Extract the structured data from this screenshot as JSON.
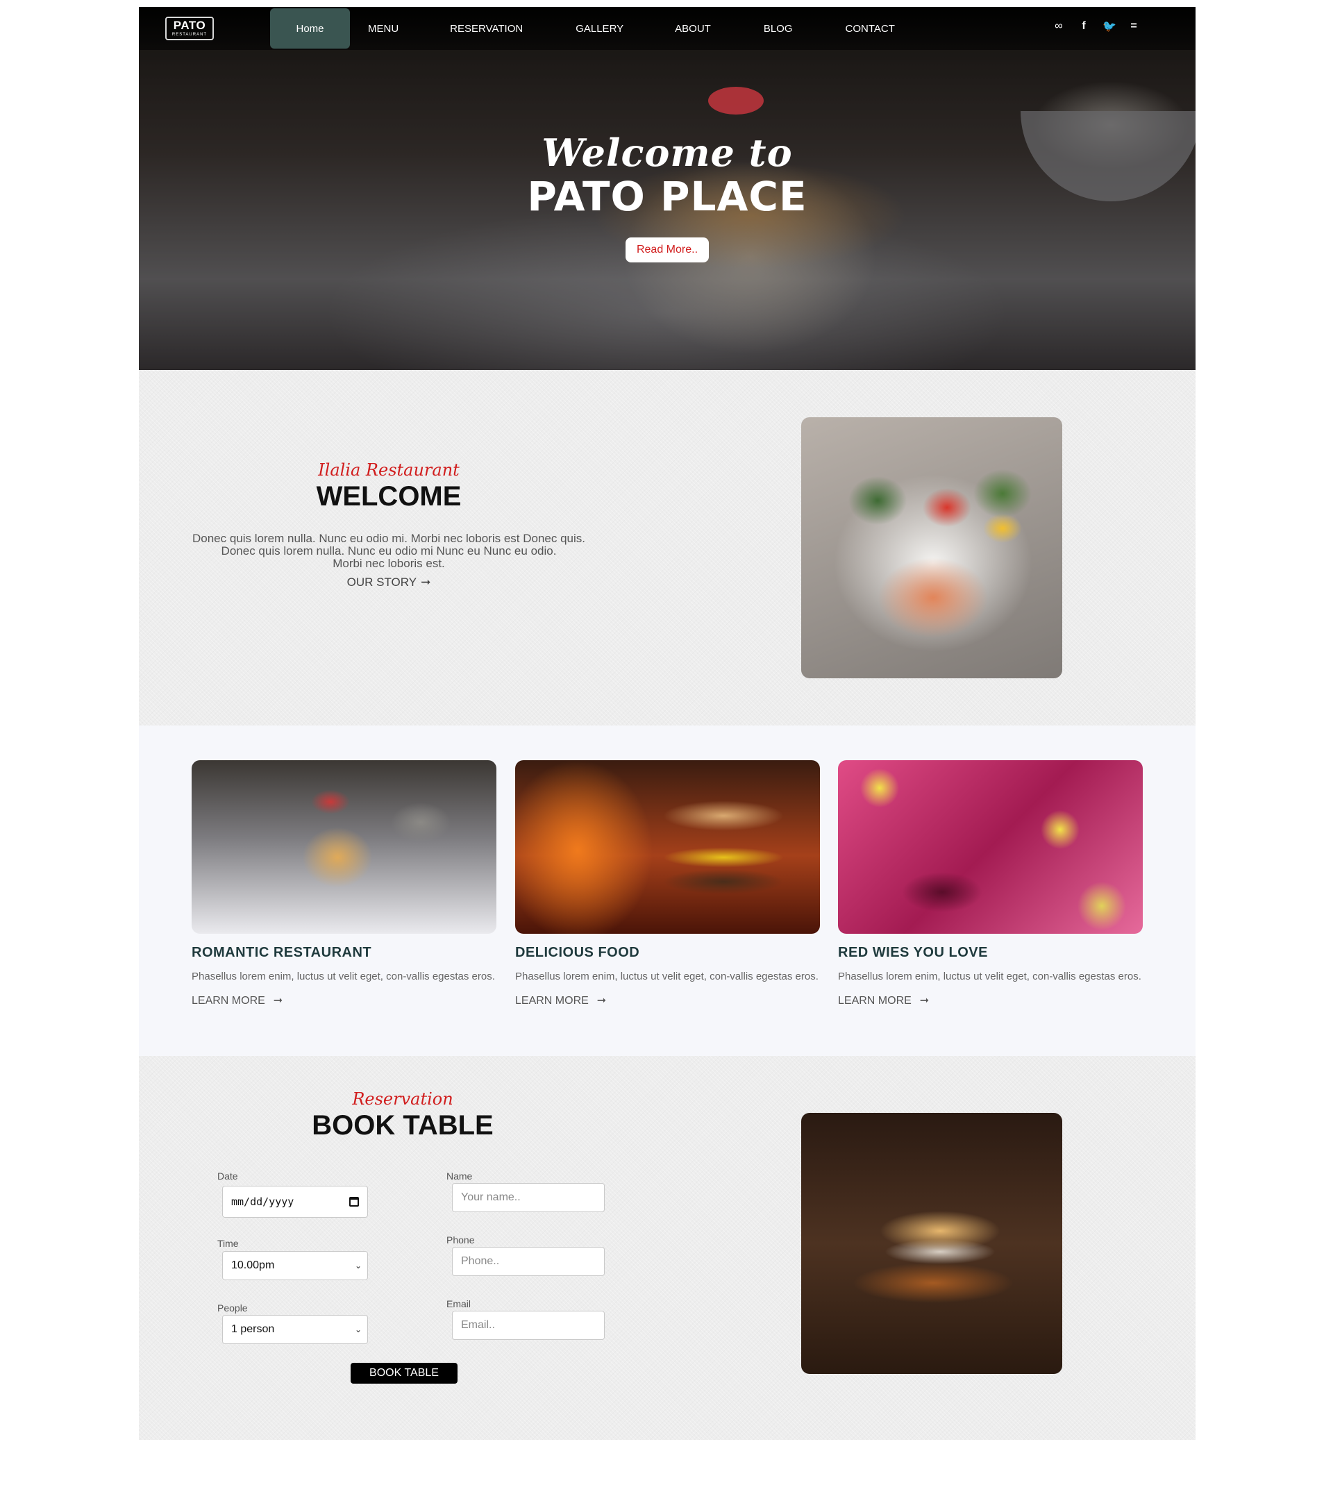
{
  "nav": {
    "logo_main": "PATO",
    "logo_sub": "RESTAURANT",
    "links": [
      "Home",
      "MENU",
      "RESERVATION",
      "GALLERY",
      "ABOUT",
      "BLOG",
      "CONTACT"
    ],
    "social": [
      "tripadvisor-icon",
      "facebook-icon",
      "twitter-icon",
      "menu-icon"
    ],
    "active_color": "#3a5551"
  },
  "hero": {
    "script": "Welcome to",
    "title": "PATO PLACE",
    "button": "Read More.."
  },
  "welcome": {
    "script": "Ilalia Restaurant",
    "title": "WELCOME",
    "paragraph_lines": [
      "Donec quis lorem nulla. Nunc eu odio mi. Morbi nec loboris est Donec quis.",
      "Donec quis lorem nulla. Nunc eu odio mi Nunc eu Nunc eu odio.",
      "Morbi nec loboris est."
    ],
    "link": "OUR STORY"
  },
  "features": [
    {
      "title": "ROMANTIC RESTAURANT",
      "text": "Phasellus lorem enim, luctus ut velit eget, con-vallis egestas eros.",
      "link": "LEARN MORE"
    },
    {
      "title": "DELICIOUS FOOD",
      "text": "Phasellus lorem enim, luctus ut velit eget, con-vallis egestas eros.",
      "link": "LEARN MORE"
    },
    {
      "title": "RED WIES YOU LOVE",
      "text": "Phasellus lorem enim, luctus ut velit eget, con-vallis egestas eros.",
      "link": "LEARN MORE"
    }
  ],
  "booking": {
    "script": "Reservation",
    "title": "BOOK TABLE",
    "date_label": "Date",
    "date_value": "mm/dd/yyyy",
    "time_label": "Time",
    "time_value": "10.00pm",
    "people_label": "People",
    "people_value": "1 person",
    "name_label": "Name",
    "name_placeholder": "Your name..",
    "phone_label": "Phone",
    "phone_placeholder": "Phone..",
    "email_label": "Email",
    "email_placeholder": "Email..",
    "button": "BOOK TABLE"
  },
  "colors": {
    "accent_red": "#d11d1d",
    "heading_teal": "#1f3a3d"
  }
}
